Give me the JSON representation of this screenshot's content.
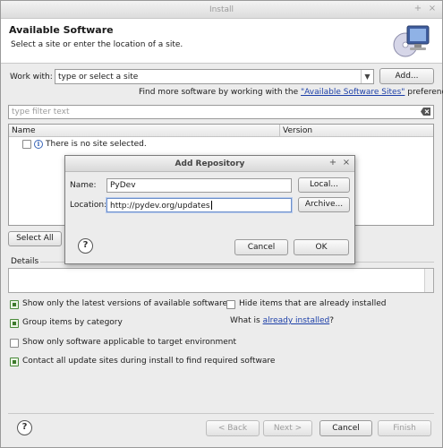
{
  "window": {
    "title": "Install"
  },
  "banner": {
    "heading": "Available Software",
    "subtitle": "Select a site or enter the location of a site."
  },
  "work_with": {
    "label": "Work with:",
    "value": "type or select a site",
    "add_button": "Add..."
  },
  "find_more": {
    "prefix": "Find more software by working with the ",
    "link": "\"Available Software Sites\"",
    "suffix": " preferences."
  },
  "filter": {
    "placeholder": "type filter text"
  },
  "table": {
    "columns": [
      "Name",
      "Version"
    ],
    "rows": [
      {
        "name": "There is no site selected.",
        "version": ""
      }
    ]
  },
  "select_all_button": "Select All",
  "details_label": "Details",
  "options": {
    "latest_versions": {
      "label": "Show only the latest versions of available software",
      "checked": true
    },
    "group_by_category": {
      "label": "Group items by category",
      "checked": true
    },
    "target_env": {
      "label": "Show only software applicable to target environment",
      "checked": false
    },
    "contact_sites": {
      "label": "Contact all update sites during install to find required software",
      "checked": true
    },
    "hide_installed": {
      "label": "Hide items that are already installed",
      "checked": false
    }
  },
  "what_is": {
    "prefix": "What is ",
    "link": "already installed",
    "suffix": "?"
  },
  "footer": {
    "back": "< Back",
    "next": "Next >",
    "cancel": "Cancel",
    "finish": "Finish"
  },
  "dialog": {
    "title": "Add Repository",
    "name_label": "Name:",
    "name_value": "PyDev",
    "location_label": "Location:",
    "location_value": "http://pydev.org/updates",
    "local_button": "Local...",
    "archive_button": "Archive...",
    "cancel_button": "Cancel",
    "ok_button": "OK"
  },
  "icons": {
    "window_minimize": "+",
    "window_close": "×",
    "dialog_minimize": "+",
    "dialog_close": "×",
    "combo_arrow": "▼",
    "help": "?",
    "info": "i"
  }
}
